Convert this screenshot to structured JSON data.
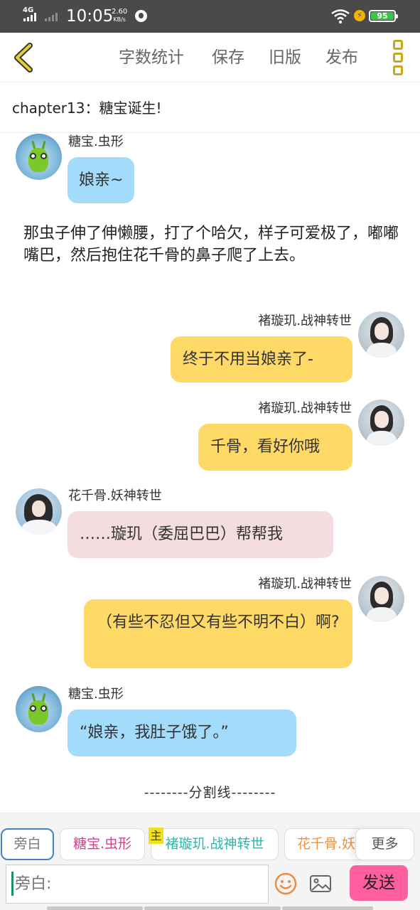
{
  "status_bar": {
    "network": "4G",
    "time": "10:05",
    "speed_value": "2.60",
    "speed_unit": "KB/s",
    "battery": "95",
    "icons": [
      "signal-icon",
      "globe-icon",
      "wifi-icon",
      "charging-icon",
      "battery-icon"
    ]
  },
  "toolbar": {
    "back_icon": "chevron-left-icon",
    "word_count": "字数统计",
    "save": "保存",
    "old_version": "旧版",
    "publish": "发布",
    "more_icon": "more-menu-icon"
  },
  "chapter": {
    "title": "chapter13：糖宝诞生!"
  },
  "messages": [
    {
      "speaker": "糖宝.虫形",
      "text": "娘亲~",
      "side": "left",
      "avatar": "caterpillar-avatar",
      "color": "#a3dcfa"
    },
    {
      "speaker": "褚璇玑.战神转世",
      "text": "终于不用当娘亲了-",
      "side": "right",
      "avatar": "girl-avatar",
      "color": "#ffd966"
    },
    {
      "speaker": "褚璇玑.战神转世",
      "text": "千骨，看好你哦",
      "side": "right",
      "avatar": "girl-avatar",
      "color": "#ffd966"
    },
    {
      "speaker": "花千骨.妖神转世",
      "text": "……璇玑（委屈巴巴）帮帮我",
      "side": "left",
      "avatar": "hua-avatar",
      "color": "#f4dde0"
    },
    {
      "speaker": "褚璇玑.战神转世",
      "text": "（有些不忍但又有些不明不白）啊?",
      "side": "right",
      "avatar": "girl-avatar",
      "color": "#ffd966"
    },
    {
      "speaker": "糖宝.虫形",
      "text": "“娘亲，我肚子饿了。”",
      "side": "left",
      "avatar": "caterpillar-avatar",
      "color": "#a3dcfa"
    }
  ],
  "narration": "那虫子伸了伸懒腰，打了个哈欠，样子可爱极了，嘟嘟嘴巴，然后抱住花千骨的鼻子爬了上去。",
  "divider": "--------分割线--------",
  "roles": [
    {
      "label": "旁白",
      "color": "#777777"
    },
    {
      "label": "糖宝.虫形",
      "color": "#d6408a"
    },
    {
      "label": "褚璇玑.战神转世",
      "color": "#2fb5a8",
      "tag": "主"
    },
    {
      "label": "花千骨.妖神转世",
      "color": "#f0913d"
    },
    {
      "label": "更多",
      "color": "#555555"
    }
  ],
  "input": {
    "placeholder": "旁白:",
    "emoji_icon": "smiley-icon",
    "image_icon": "image-icon",
    "send": "发送"
  }
}
